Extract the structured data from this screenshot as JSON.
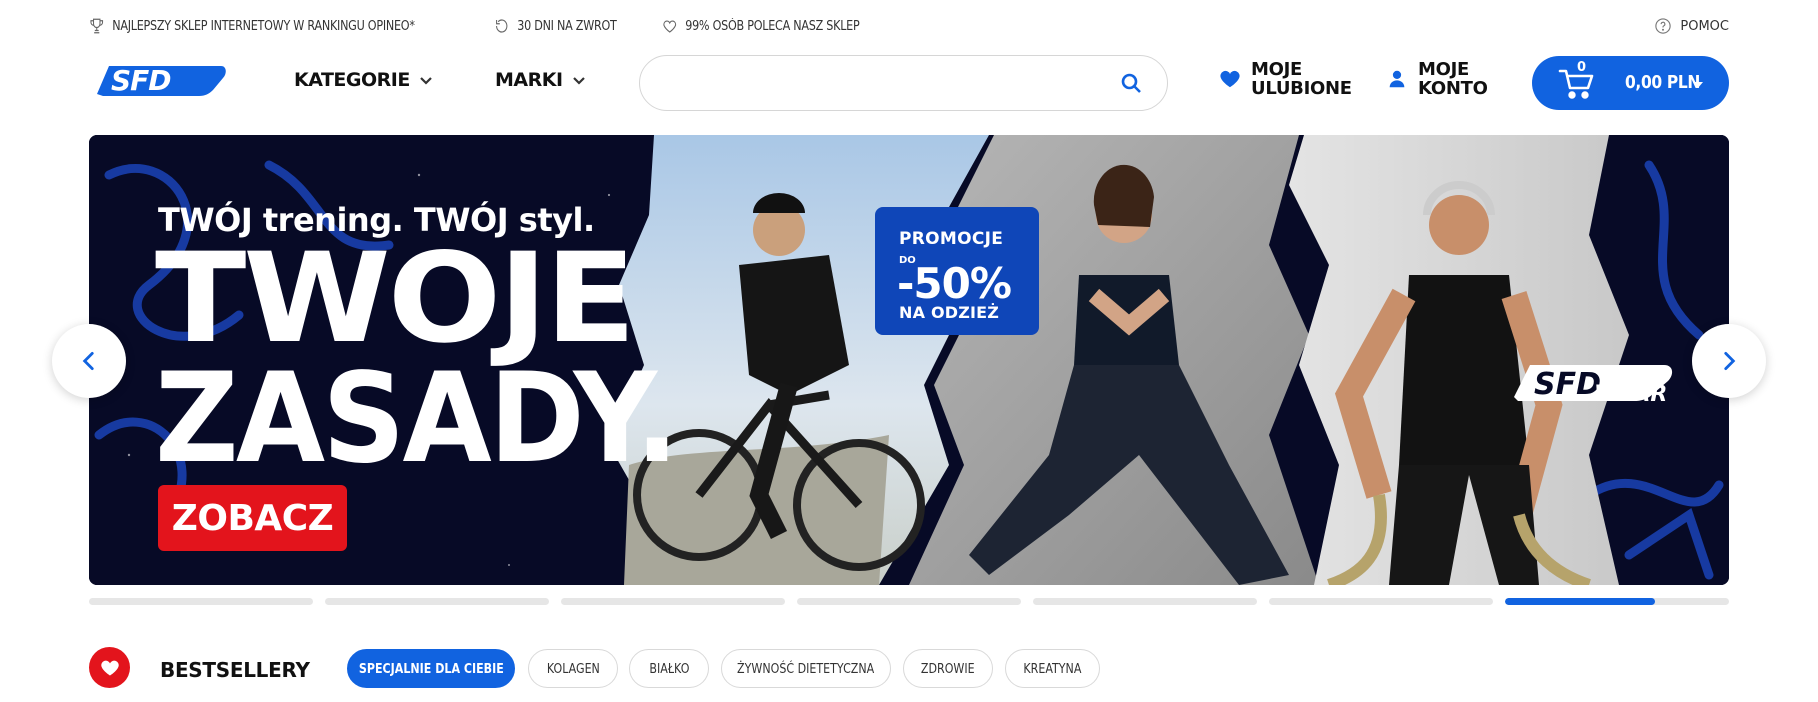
{
  "topbar": {
    "items": [
      {
        "icon": "trophy-icon",
        "label": "NAJLEPSZY SKLEP INTERNETOWY W RANKINGU OPINEO*"
      },
      {
        "icon": "return-icon",
        "label": "30 DNI NA ZWROT"
      },
      {
        "icon": "heart-outline-icon",
        "label": "99% OSÓB POLECA NASZ SKLEP"
      }
    ],
    "help_label": "POMOC"
  },
  "header": {
    "logo_text": "SFD",
    "nav": [
      {
        "label": "KATEGORIE"
      },
      {
        "label": "MARKI"
      }
    ],
    "search": {
      "value": "",
      "placeholder": ""
    },
    "favorites_label": "MOJE ULUBIONE",
    "account_label": "MOJE KONTO",
    "cart": {
      "count": "0",
      "amount": "0,00 PLN"
    }
  },
  "hero": {
    "subtitle": "TWÓJ trening. TWÓJ styl.",
    "headline_line1": "TWOJE",
    "headline_line2": "ZASADY.",
    "cta_label": "ZOBACZ",
    "promo": {
      "line1": "PROMOCJE",
      "prefix": "DO",
      "value": "-50%",
      "line2": "NA ODZIEŻ"
    },
    "brand_logo": "SFD",
    "brand_sub": "WEAR"
  },
  "slider": {
    "slide_count": 7,
    "active_index": 6,
    "active_progress": 0.67
  },
  "bestsellers": {
    "title": "BESTSELLERY",
    "tabs": [
      {
        "label": "SPECJALNIE DLA CIEBIE",
        "active": true
      },
      {
        "label": "KOLAGEN",
        "active": false
      },
      {
        "label": "BIAŁKO",
        "active": false
      },
      {
        "label": "ŻYWNOŚĆ DIETETYCZNA",
        "active": false
      },
      {
        "label": "ZDROWIE",
        "active": false
      },
      {
        "label": "KREATYNA",
        "active": false
      }
    ]
  },
  "colors": {
    "accent_blue": "#1163e0",
    "brand_red": "#e3141c",
    "hero_dark": "#070a26"
  }
}
